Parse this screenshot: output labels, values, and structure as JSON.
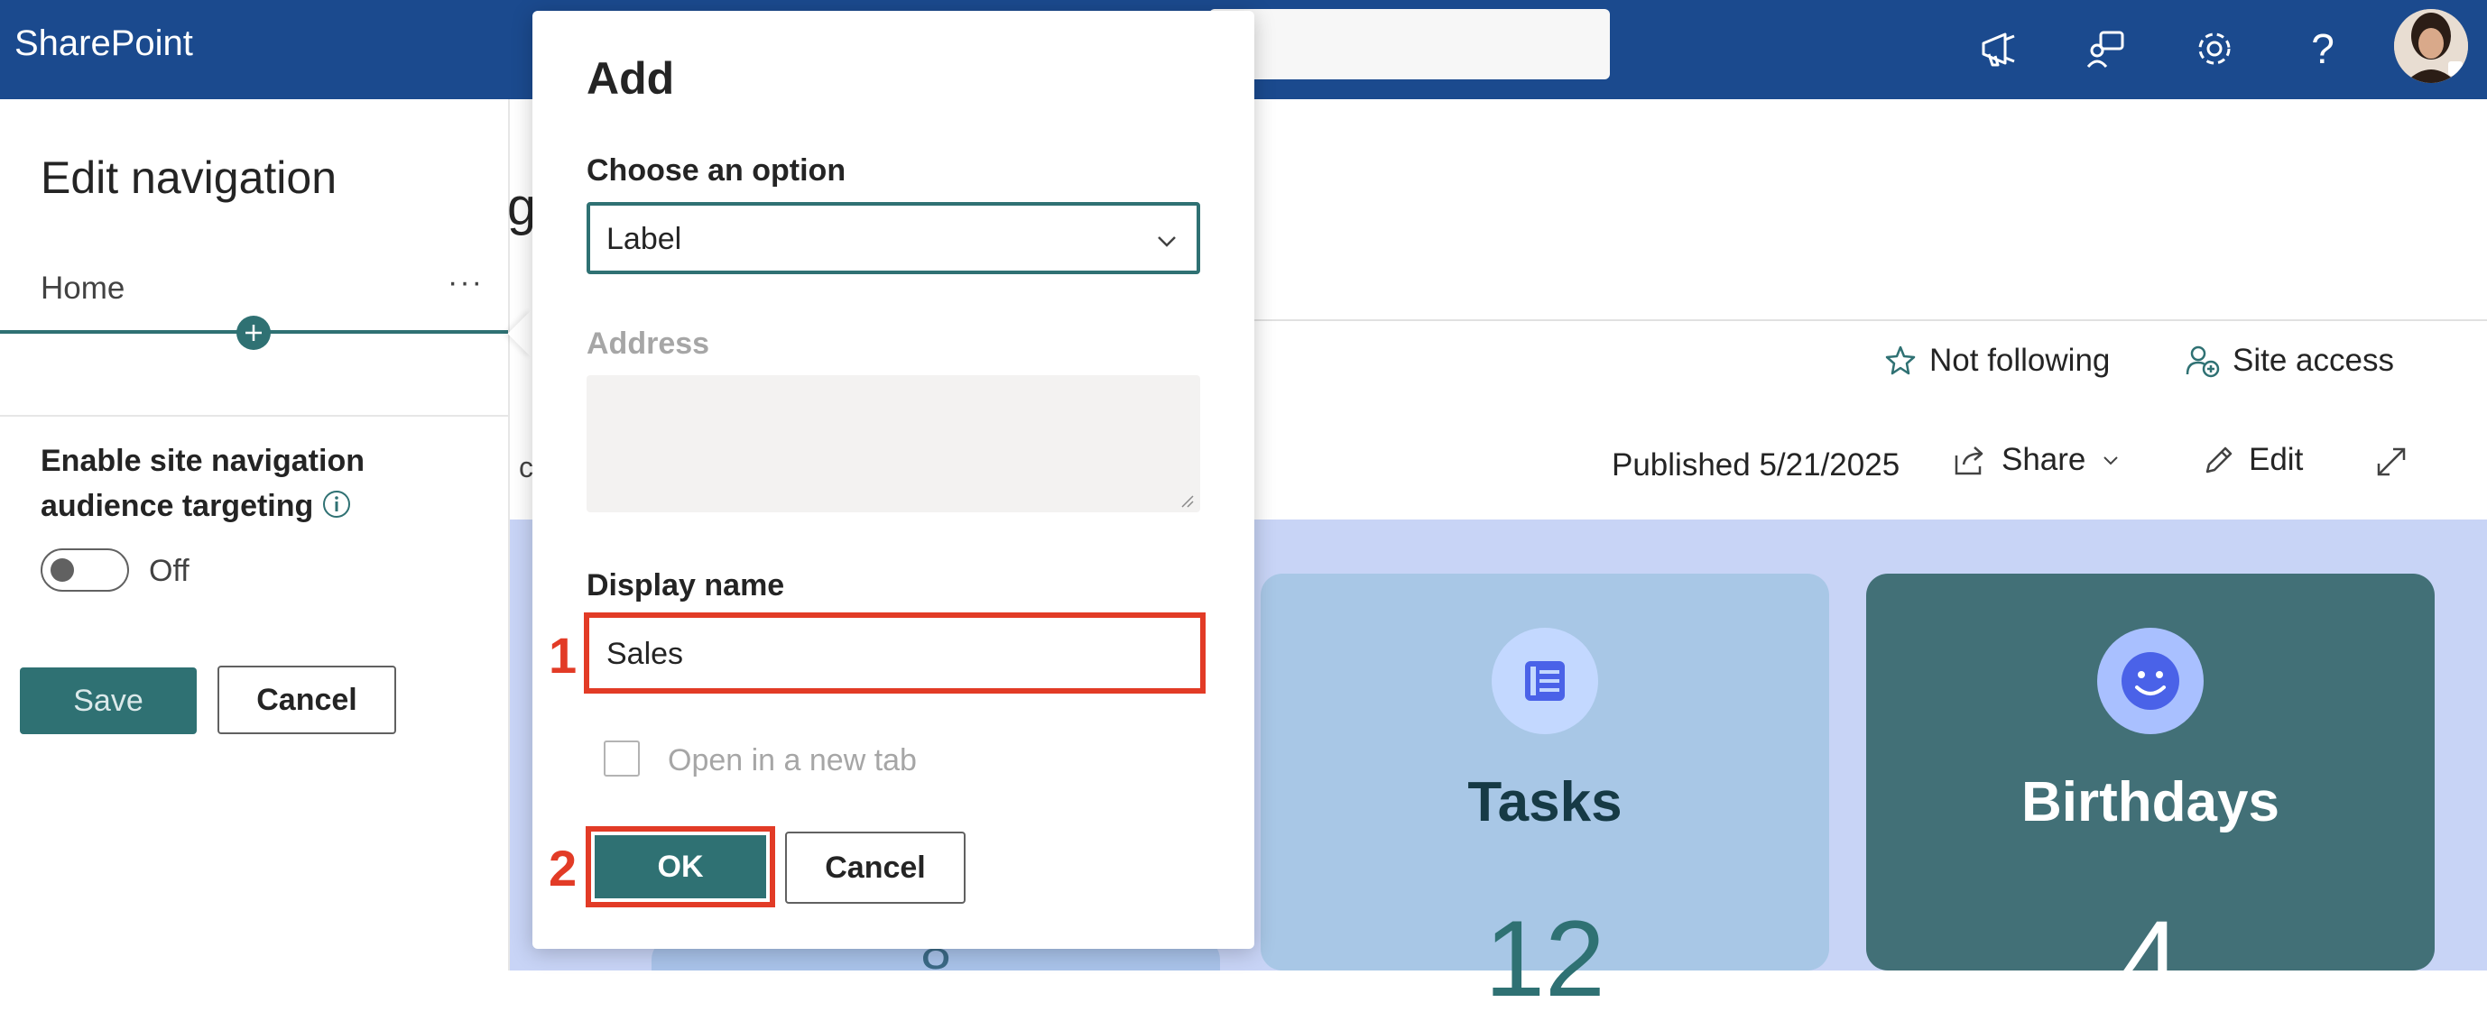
{
  "app": {
    "brand": "SharePoint"
  },
  "topbar": {
    "icons": [
      "megaphone-icon",
      "chat-feedback-icon",
      "gear-icon",
      "help-icon"
    ],
    "help_glyph": "?"
  },
  "edit_navigation": {
    "title": "Edit navigation",
    "items": [
      {
        "label": "Home"
      }
    ],
    "more_glyph": "···",
    "audience_targeting_label": "Enable site navigation audience targeting",
    "toggle_state": "Off",
    "save_label": "Save",
    "cancel_label": "Cancel"
  },
  "page": {
    "fragment_heading": "g",
    "fragment_text": "c",
    "not_following_label": "Not following",
    "site_access_label": "Site access",
    "published_label": "Published 5/21/2025",
    "share_label": "Share",
    "edit_label": "Edit",
    "cards": [
      {
        "title": "",
        "count": "8"
      },
      {
        "title": "Tasks",
        "count": "12"
      },
      {
        "title": "Birthdays",
        "count": "4"
      }
    ]
  },
  "add_dialog": {
    "title": "Add",
    "choose_option_label": "Choose an option",
    "choose_option_value": "Label",
    "address_label": "Address",
    "address_value": "",
    "display_name_label": "Display name",
    "display_name_value": "Sales",
    "open_new_tab_label": "Open in a new tab",
    "open_new_tab_checked": false,
    "ok_label": "OK",
    "cancel_label": "Cancel"
  },
  "annotations": {
    "step1": "1",
    "step2": "2",
    "highlight_color": "#e23b26"
  },
  "colors": {
    "suite_bar": "#1b4a8e",
    "accent": "#2f7173",
    "hero_bg": "#c8d4f6"
  }
}
